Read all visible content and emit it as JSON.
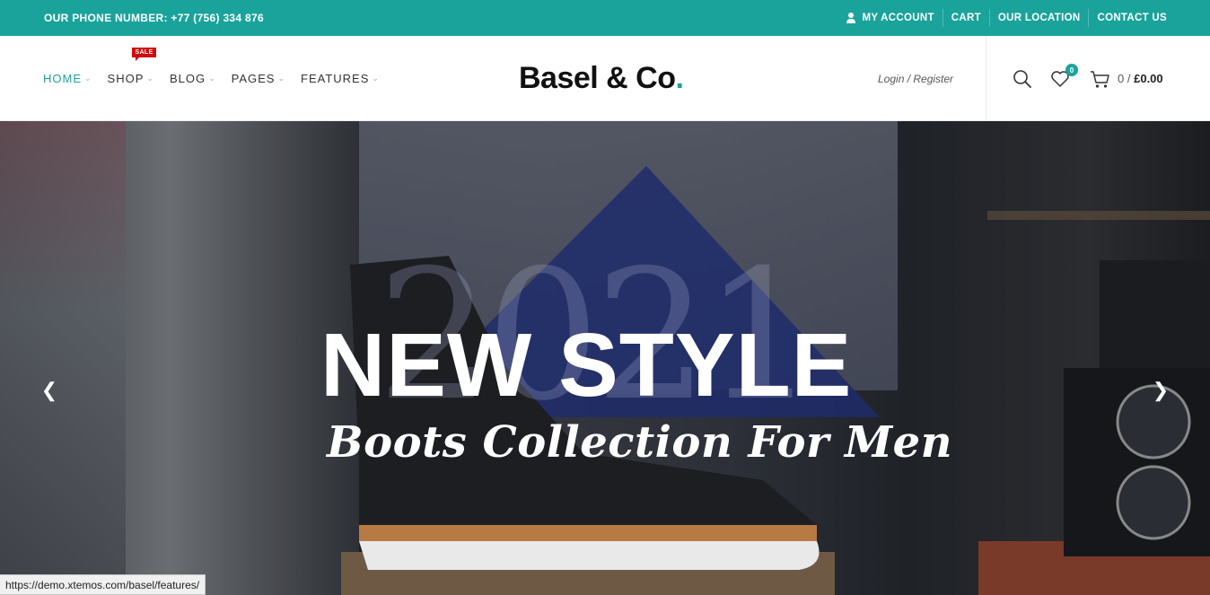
{
  "topbar": {
    "phone": "OUR PHONE NUMBER: +77 (756) 334 876",
    "links": [
      "MY ACCOUNT",
      "CART",
      "OUR LOCATION",
      "CONTACT US"
    ]
  },
  "nav": {
    "items": [
      {
        "label": "HOME"
      },
      {
        "label": "SHOP",
        "badge": "SALE"
      },
      {
        "label": "BLOG"
      },
      {
        "label": "PAGES"
      },
      {
        "label": "FEATURES"
      }
    ]
  },
  "logo": {
    "text": "Basel & Co",
    "dot": "."
  },
  "account": {
    "login": "Login / Register"
  },
  "wishlist": {
    "count": "0"
  },
  "cart": {
    "count": "0",
    "separator": "/",
    "total": "£0.00"
  },
  "hero": {
    "year": "2021",
    "headline": "NEW STYLE",
    "subline": "Boots Collection For Men"
  },
  "status_bar": {
    "url": "https://demo.xtemos.com/basel/features/"
  },
  "colors": {
    "accent": "#1aa39a",
    "sale": "#d20a0a"
  },
  "icons": [
    "user-icon",
    "search-icon",
    "heart-icon",
    "cart-icon",
    "chevron-left-icon",
    "chevron-right-icon"
  ]
}
